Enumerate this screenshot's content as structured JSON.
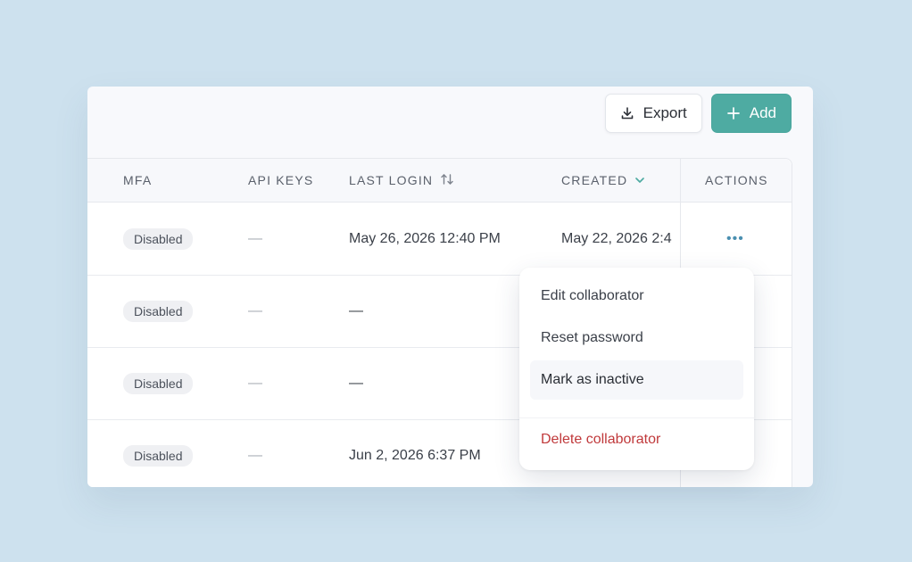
{
  "toolbar": {
    "export_label": "Export",
    "add_label": "Add"
  },
  "table": {
    "columns": {
      "mfa": "MFA",
      "api_keys": "API KEYS",
      "last_login": "LAST LOGIN",
      "created": "CREATED",
      "actions": "ACTIONS"
    },
    "rows": [
      {
        "mfa": "Disabled",
        "api_keys": "—",
        "last_login": "May 26, 2026 12:40 PM",
        "created": "May 22, 2026 2:4",
        "actions": "•••"
      },
      {
        "mfa": "Disabled",
        "api_keys": "—",
        "last_login": "—",
        "created": "",
        "actions": ""
      },
      {
        "mfa": "Disabled",
        "api_keys": "—",
        "last_login": "—",
        "created": "",
        "actions": ""
      },
      {
        "mfa": "Disabled",
        "api_keys": "—",
        "last_login": "Jun 2, 2026 6:37 PM",
        "created": "",
        "actions": ""
      }
    ]
  },
  "menu": {
    "items": [
      {
        "label": "Edit collaborator"
      },
      {
        "label": "Reset password"
      },
      {
        "label": "Mark as inactive"
      },
      {
        "label": "Delete collaborator"
      }
    ]
  },
  "colors": {
    "accent": "#4eaba2",
    "danger": "#c0393b",
    "background": "#cde1ee"
  },
  "icons": {
    "export": "download-icon",
    "add": "plus-icon",
    "sort": "sort-arrows-icon",
    "sorted": "chevron-down-icon",
    "row_actions": "more-horizontal-icon"
  }
}
